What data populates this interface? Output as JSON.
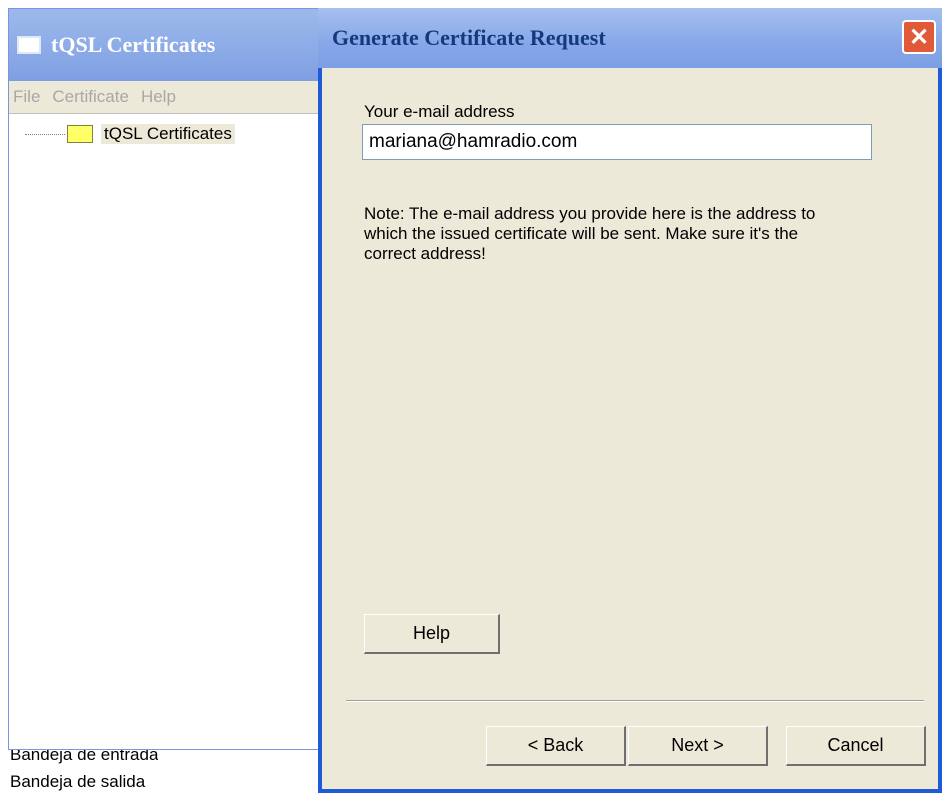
{
  "background_window": {
    "title": "tQSL Certificates",
    "menu": [
      "File",
      "Certificate",
      "Help"
    ],
    "tree_item": "tQSL Certificates"
  },
  "taskbar": {
    "line1": "Bandeja de entrada",
    "line2": "Bandeja de salida"
  },
  "dialog": {
    "title": "Generate Certificate Request",
    "close_symbol": "✕",
    "email_label": "Your e-mail address",
    "email_value": "mariana@hamradio.com",
    "note": "Note: The e-mail address you provide here is the address to which the issued certificate will be sent. Make sure it's the correct address!",
    "help_button": "Help",
    "back_button": "< Back",
    "next_button": "Next >",
    "cancel_button": "Cancel"
  },
  "colors": {
    "dialog_face": "#ece9d8",
    "title_text": "#133a7e",
    "close_button": "#e05a3a"
  }
}
